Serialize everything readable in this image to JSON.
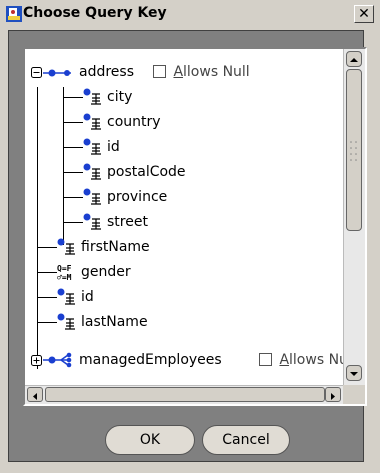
{
  "window": {
    "title": "Choose Query Key",
    "close_glyph": "✕"
  },
  "tree": {
    "items": [
      {
        "label": "address",
        "type": "aggregate",
        "expanded": true,
        "nullable_label": "Allows Null",
        "nullable_mnemonic": "A"
      },
      {
        "label": "city",
        "type": "direct"
      },
      {
        "label": "country",
        "type": "direct"
      },
      {
        "label": "id",
        "type": "direct"
      },
      {
        "label": "postalCode",
        "type": "direct"
      },
      {
        "label": "province",
        "type": "direct"
      },
      {
        "label": "street",
        "type": "direct"
      },
      {
        "label": "firstName",
        "type": "direct"
      },
      {
        "label": "gender",
        "type": "object-type"
      },
      {
        "label": "id",
        "type": "direct"
      },
      {
        "label": "lastName",
        "type": "direct"
      },
      {
        "label": "managedEmployees",
        "type": "collection",
        "expanded": false,
        "nullable_label": "Allows Nu",
        "nullable_mnemonic": "A"
      }
    ]
  },
  "buttons": {
    "ok": "OK",
    "cancel": "Cancel"
  },
  "icons": {
    "title": "app-icon",
    "expand": "minus-box-icon",
    "collapse": "plus-box-icon",
    "aggregate": "aggregate-mapping-icon",
    "direct": "direct-mapping-icon",
    "object_type": "object-type-mapping-icon",
    "collection": "collection-mapping-icon"
  },
  "colors": {
    "dialog_bg": "#d4d0c8",
    "panel_bg": "#808080",
    "mapping_blue": "#1a3fd0"
  }
}
